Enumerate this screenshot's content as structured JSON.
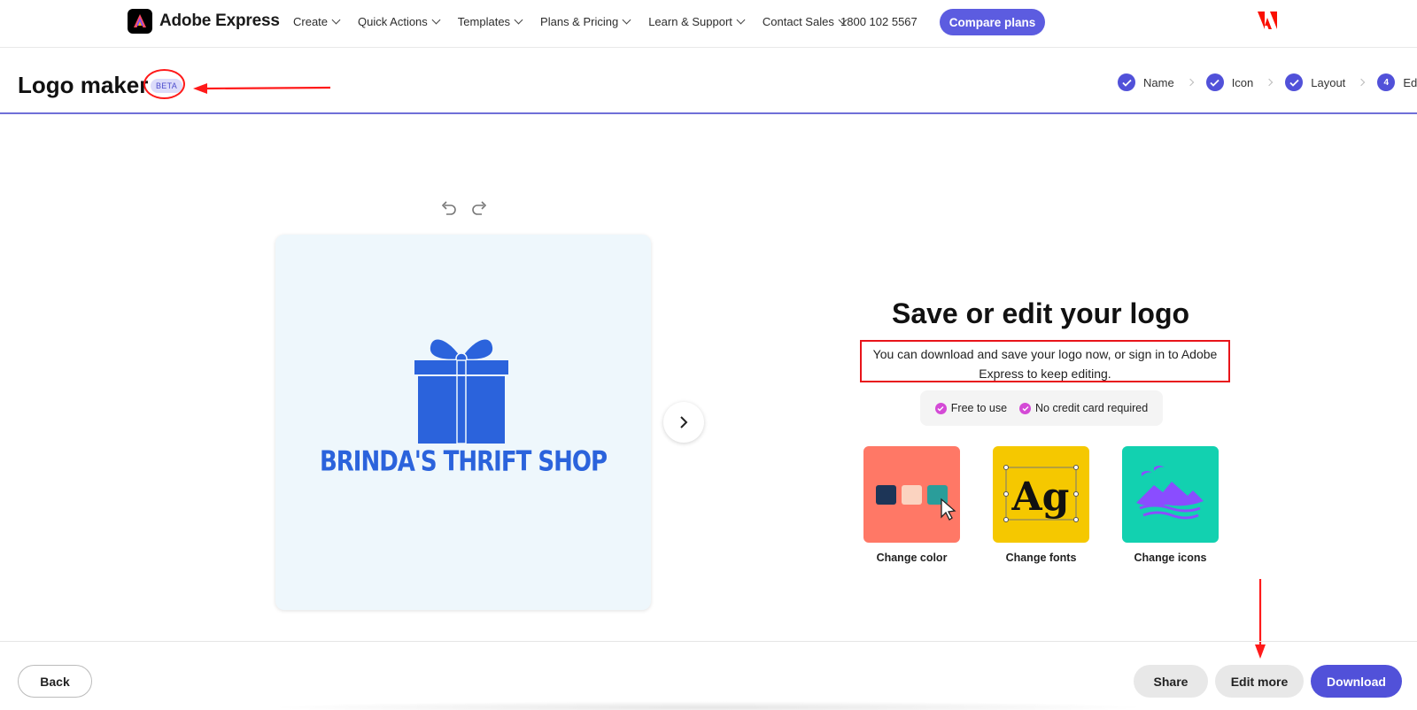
{
  "nav": {
    "brand": "Adobe Express",
    "items": [
      {
        "label": "Create"
      },
      {
        "label": "Quick Actions"
      },
      {
        "label": "Templates"
      },
      {
        "label": "Plans & Pricing"
      },
      {
        "label": "Learn & Support"
      },
      {
        "label": "Contact Sales"
      }
    ],
    "phone": "1800 102 5567",
    "cta": "Compare plans"
  },
  "header": {
    "title": "Logo maker",
    "badge": "BETA",
    "steps": [
      {
        "label": "Name",
        "state": "done"
      },
      {
        "label": "Icon",
        "state": "done"
      },
      {
        "label": "Layout",
        "state": "done"
      },
      {
        "label": "Edit",
        "state": "current",
        "number": "4"
      }
    ]
  },
  "canvas": {
    "logo_text": "BRINDA'S THRIFT SHOP",
    "logo_icon": "gift-box-icon"
  },
  "panel": {
    "title": "Save or edit your logo",
    "description": "You can download and save your logo now, or sign in to Adobe Express to keep editing.",
    "badges": [
      "Free to use",
      "No credit card required"
    ],
    "cards": [
      {
        "label": "Change color",
        "color": "#ff7866"
      },
      {
        "label": "Change fonts",
        "color": "#f5c800"
      },
      {
        "label": "Change icons",
        "color": "#12d1b0"
      }
    ]
  },
  "footer": {
    "back": "Back",
    "share": "Share",
    "edit_more": "Edit more",
    "download": "Download"
  },
  "colors": {
    "accent": "#5151d9",
    "logo_blue": "#2b63dc",
    "annotation_red": "#ff1a1a"
  }
}
